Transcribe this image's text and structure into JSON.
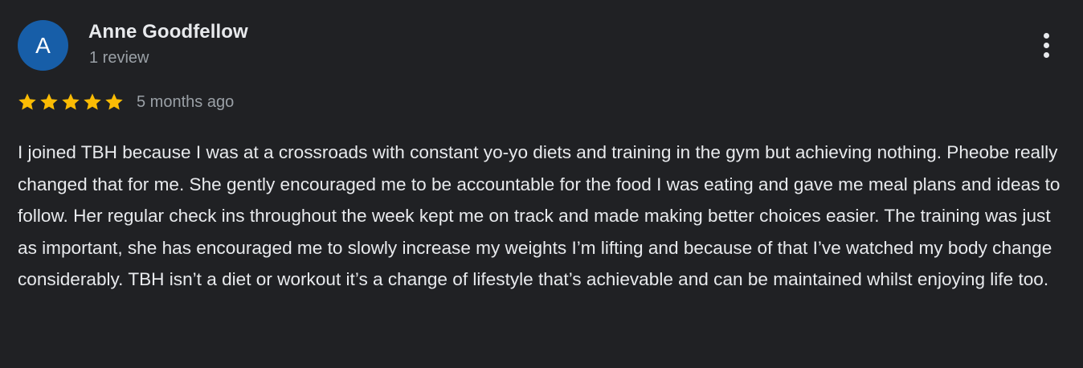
{
  "review": {
    "avatar_letter": "A",
    "avatar_color": "#175ea8",
    "reviewer_name": "Anne Goodfellow",
    "review_count": "1 review",
    "rating": 5,
    "rating_max": 5,
    "star_color": "#fbbc04",
    "date": "5 months ago",
    "text": "I joined TBH because I was at a crossroads with constant yo-yo diets and training in the gym but achieving nothing. Pheobe really changed that for me. She gently encouraged me to be accountable for the food I was eating and gave me meal plans and ideas to follow. Her regular check ins throughout the week kept me on track and made making better choices easier. The training was just as important, she has encouraged me to slowly increase my weights I’m lifting and because of that I’ve watched my body change considerably. TBH isn’t a diet or workout it’s a change of lifestyle that’s achievable and can be maintained whilst enjoying life too.",
    "more_icon": "more-vertical-icon",
    "star_icon": "star-icon"
  }
}
